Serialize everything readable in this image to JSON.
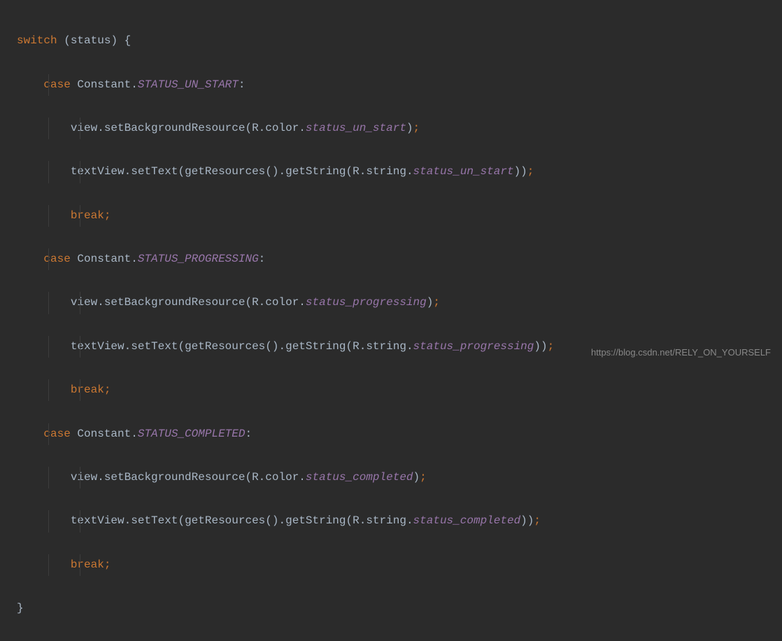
{
  "code": {
    "switch_kw": "switch",
    "status_var": "status",
    "case_kw": "case",
    "break_kw": "break",
    "constant_class": "Constant",
    "view_obj": "view",
    "textview_obj": "textView",
    "setbg_method": "setBackgroundResource",
    "settext_method": "setText",
    "getres_method": "getResources",
    "getstring_method": "getString",
    "r_color": "R.color.",
    "r_string": "R.string.",
    "cases": [
      {
        "status_const": "STATUS_UN_START",
        "color_const": "status_un_start",
        "string_const": "status_un_start"
      },
      {
        "status_const": "STATUS_PROGRESSING",
        "color_const": "status_progressing",
        "string_const": "status_progressing"
      },
      {
        "status_const": "STATUS_COMPLETED",
        "color_const": "status_completed",
        "string_const": "status_completed"
      }
    ]
  },
  "watermark": "https://blog.csdn.net/RELY_ON_YOURSELF"
}
